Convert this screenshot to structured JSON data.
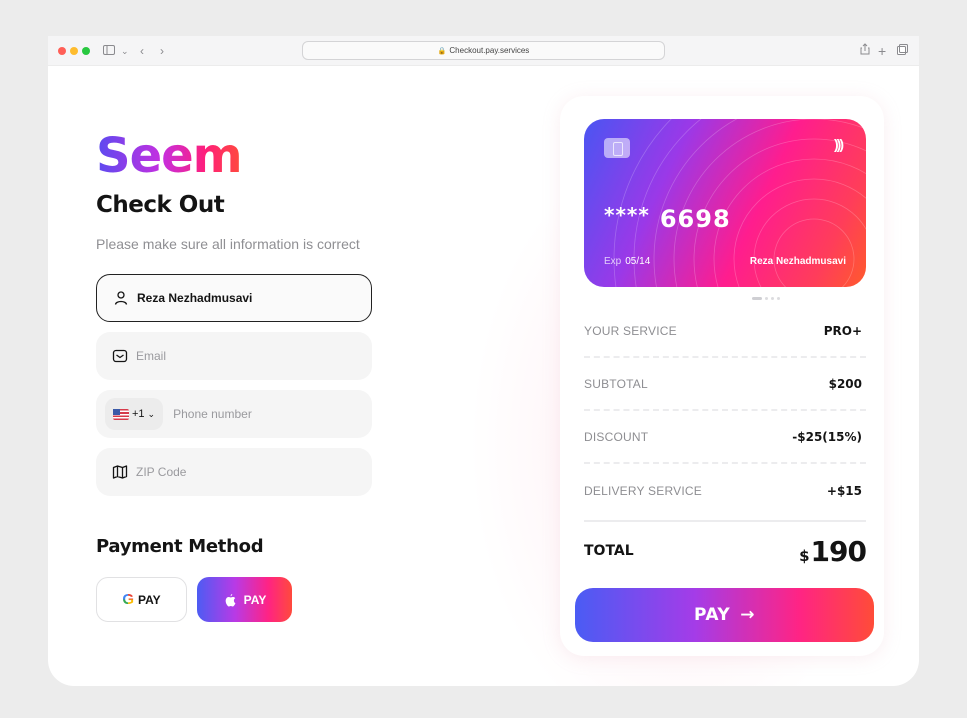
{
  "browser": {
    "url": "Checkout.pay.services"
  },
  "brand": {
    "logo": "Seem"
  },
  "checkout": {
    "title": "Check Out",
    "subtitle": "Please make sure all information is correct",
    "fields": {
      "name_value": "Reza Nezhadmusavi",
      "email_placeholder": "Email",
      "country_code": "+1",
      "phone_placeholder": "Phone number",
      "zip_placeholder": "ZIP Code"
    }
  },
  "payment": {
    "title": "Payment Method",
    "gpay_label": "PAY",
    "gpay_g": "G",
    "applepay_label": "PAY"
  },
  "card": {
    "masked": "****",
    "last4": "6698",
    "exp_label": "Exp",
    "exp_value": "05/14",
    "holder": "Reza Nezhadmusavi",
    "nfc_glyph": ")))"
  },
  "summary": {
    "rows": [
      {
        "label": "YOUR SERVICE",
        "value": "PRO+"
      },
      {
        "label": "SUBTOTAL",
        "value": "$200"
      },
      {
        "label": "DISCOUNT",
        "value": "-$25(15%)"
      },
      {
        "label": "DELIVERY SERVICE",
        "value": "+$15"
      }
    ],
    "total_label": "TOTAL",
    "total_currency": "$",
    "total_amount": "190"
  },
  "pay_button": {
    "label": "PAY",
    "arrow": "→"
  },
  "colors": {
    "gradient_start": "#4a5cf4",
    "gradient_mid": "#ff2484",
    "gradient_end": "#ff4c38"
  }
}
